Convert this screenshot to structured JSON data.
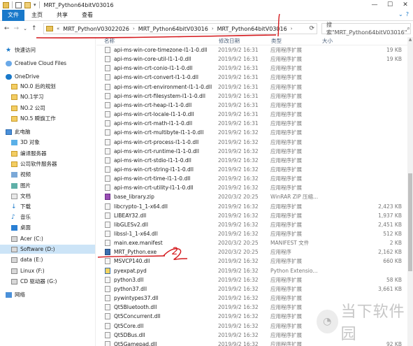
{
  "window": {
    "title": "MRT_Python64bitV03016",
    "controls": [
      "—",
      "☐",
      "✕"
    ]
  },
  "ribbon": {
    "tabs": [
      "文件",
      "主页",
      "共享",
      "查看"
    ]
  },
  "address": {
    "breadcrumbs": [
      "MRT_PythonV03022026",
      "MRT_Python64bitV03016",
      "MRT_Python64bitV03016"
    ],
    "search_placeholder": "搜索\"MRT_Python64bitV03016\""
  },
  "sidebar": {
    "items": [
      {
        "label": "快速访问",
        "icon": "star-icon"
      },
      {
        "label": "Creative Cloud Files",
        "icon": "cloud-icon"
      },
      {
        "label": "OneDrive",
        "icon": "onedrive-icon"
      },
      {
        "label": "NO.0 后的规划",
        "icon": "folder-icon"
      },
      {
        "label": "NO.1学习",
        "icon": "folder-icon"
      },
      {
        "label": "NO.2 公司",
        "icon": "folder-icon"
      },
      {
        "label": "NO.5 瞬旗工作",
        "icon": "folder-icon"
      },
      {
        "label": "此电脑",
        "icon": "pc-icon"
      },
      {
        "label": "3D 对象",
        "icon": "cube-icon"
      },
      {
        "label": "编译服务器",
        "icon": "folder-icon"
      },
      {
        "label": "公司软件服务器",
        "icon": "folder-icon"
      },
      {
        "label": "视频",
        "icon": "video-icon"
      },
      {
        "label": "图片",
        "icon": "image-icon"
      },
      {
        "label": "文档",
        "icon": "document-icon"
      },
      {
        "label": "下载",
        "icon": "download-icon"
      },
      {
        "label": "音乐",
        "icon": "music-icon"
      },
      {
        "label": "桌面",
        "icon": "desktop-icon"
      },
      {
        "label": "Acer (C:)",
        "icon": "drive-icon"
      },
      {
        "label": "Software (D:)",
        "icon": "drive-icon"
      },
      {
        "label": "data (E:)",
        "icon": "drive-icon"
      },
      {
        "label": "Linux (F:)",
        "icon": "drive-icon"
      },
      {
        "label": "CD 驱动器 (G:)",
        "icon": "drive-icon"
      },
      {
        "label": "网络",
        "icon": "network-icon"
      }
    ]
  },
  "columns": {
    "name": "名称",
    "date": "修改日期",
    "type": "类型",
    "size": "大小"
  },
  "files": [
    {
      "name": "api-ms-win-core-timezone-l1-1-0.dll",
      "date": "2019/9/2 16:31",
      "type": "应用程序扩展",
      "size": "19 KB",
      "kind": "dll"
    },
    {
      "name": "api-ms-win-core-util-l1-1-0.dll",
      "date": "2019/9/2 16:31",
      "type": "应用程序扩展",
      "size": "19 KB",
      "kind": "dll"
    },
    {
      "name": "api-ms-win-crt-conio-l1-1-0.dll",
      "date": "2019/9/2 16:31",
      "type": "应用程序扩展",
      "size": "",
      "kind": "dll"
    },
    {
      "name": "api-ms-win-crt-convert-l1-1-0.dll",
      "date": "2019/9/2 16:31",
      "type": "应用程序扩展",
      "size": "",
      "kind": "dll"
    },
    {
      "name": "api-ms-win-crt-environment-l1-1-0.dll",
      "date": "2019/9/2 16:31",
      "type": "应用程序扩展",
      "size": "",
      "kind": "dll"
    },
    {
      "name": "api-ms-win-crt-filesystem-l1-1-0.dll",
      "date": "2019/9/2 16:31",
      "type": "应用程序扩展",
      "size": "",
      "kind": "dll"
    },
    {
      "name": "api-ms-win-crt-heap-l1-1-0.dll",
      "date": "2019/9/2 16:31",
      "type": "应用程序扩展",
      "size": "",
      "kind": "dll"
    },
    {
      "name": "api-ms-win-crt-locale-l1-1-0.dll",
      "date": "2019/9/2 16:31",
      "type": "应用程序扩展",
      "size": "",
      "kind": "dll"
    },
    {
      "name": "api-ms-win-crt-math-l1-1-0.dll",
      "date": "2019/9/2 16:31",
      "type": "应用程序扩展",
      "size": "",
      "kind": "dll"
    },
    {
      "name": "api-ms-win-crt-multibyte-l1-1-0.dll",
      "date": "2019/9/2 16:32",
      "type": "应用程序扩展",
      "size": "",
      "kind": "dll"
    },
    {
      "name": "api-ms-win-crt-process-l1-1-0.dll",
      "date": "2019/9/2 16:32",
      "type": "应用程序扩展",
      "size": "",
      "kind": "dll"
    },
    {
      "name": "api-ms-win-crt-runtime-l1-1-0.dll",
      "date": "2019/9/2 16:32",
      "type": "应用程序扩展",
      "size": "",
      "kind": "dll"
    },
    {
      "name": "api-ms-win-crt-stdio-l1-1-0.dll",
      "date": "2019/9/2 16:32",
      "type": "应用程序扩展",
      "size": "",
      "kind": "dll"
    },
    {
      "name": "api-ms-win-crt-string-l1-1-0.dll",
      "date": "2019/9/2 16:32",
      "type": "应用程序扩展",
      "size": "",
      "kind": "dll"
    },
    {
      "name": "api-ms-win-crt-time-l1-1-0.dll",
      "date": "2019/9/2 16:32",
      "type": "应用程序扩展",
      "size": "",
      "kind": "dll"
    },
    {
      "name": "api-ms-win-crt-utility-l1-1-0.dll",
      "date": "2019/9/2 16:32",
      "type": "应用程序扩展",
      "size": "",
      "kind": "dll"
    },
    {
      "name": "base_library.zip",
      "date": "2020/3/2 20:25",
      "type": "WinRAR ZIP 压缩...",
      "size": "",
      "kind": "zip"
    },
    {
      "name": "libcrypto-1_1-x64.dll",
      "date": "2019/9/2 16:32",
      "type": "应用程序扩展",
      "size": "2,423 KB",
      "kind": "dll"
    },
    {
      "name": "LIBEAY32.dll",
      "date": "2019/9/2 16:32",
      "type": "应用程序扩展",
      "size": "1,937 KB",
      "kind": "dll"
    },
    {
      "name": "libGLESv2.dll",
      "date": "2019/9/2 16:32",
      "type": "应用程序扩展",
      "size": "2,451 KB",
      "kind": "dll"
    },
    {
      "name": "libssl-1_1-x64.dll",
      "date": "2019/9/2 16:32",
      "type": "应用程序扩展",
      "size": "512 KB",
      "kind": "dll"
    },
    {
      "name": "main.exe.manifest",
      "date": "2020/3/2 20:25",
      "type": "MANIFEST 文件",
      "size": "2 KB",
      "kind": "doc"
    },
    {
      "name": "MRT_Python.exe",
      "date": "2020/3/2 20:25",
      "type": "应用程序",
      "size": "2,162 KB",
      "kind": "exe"
    },
    {
      "name": "MSVCP140.dll",
      "date": "2019/9/2 16:32",
      "type": "应用程序扩展",
      "size": "660 KB",
      "kind": "dll"
    },
    {
      "name": "pyexpat.pyd",
      "date": "2019/9/2 16:32",
      "type": "Python Extensio...",
      "size": "",
      "kind": "py"
    },
    {
      "name": "python3.dll",
      "date": "2019/9/2 16:32",
      "type": "应用程序扩展",
      "size": "58 KB",
      "kind": "dll"
    },
    {
      "name": "python37.dll",
      "date": "2019/9/2 16:32",
      "type": "应用程序扩展",
      "size": "3,661 KB",
      "kind": "dll"
    },
    {
      "name": "pywintypes37.dll",
      "date": "2019/9/2 16:32",
      "type": "应用程序扩展",
      "size": "",
      "kind": "dll"
    },
    {
      "name": "Qt5Bluetooth.dll",
      "date": "2019/9/2 16:32",
      "type": "应用程序扩展",
      "size": "",
      "kind": "dll"
    },
    {
      "name": "Qt5Concurrent.dll",
      "date": "2019/9/2 16:32",
      "type": "应用程序扩展",
      "size": "",
      "kind": "dll"
    },
    {
      "name": "Qt5Core.dll",
      "date": "2019/9/2 16:32",
      "type": "应用程序扩展",
      "size": "",
      "kind": "dll"
    },
    {
      "name": "Qt5DBus.dll",
      "date": "2019/9/2 16:32",
      "type": "应用程序扩展",
      "size": "",
      "kind": "dll"
    },
    {
      "name": "Qt5Gamepad.dll",
      "date": "2019/9/2 16:32",
      "type": "应用程序扩展",
      "size": "92 KB",
      "kind": "dll"
    }
  ],
  "annotation": {
    "step_number": "2"
  },
  "watermark": {
    "text": "当下软件园"
  },
  "colors": {
    "accent": "#1979ca",
    "selection": "#cce4f7",
    "marker": "#d4181c"
  }
}
